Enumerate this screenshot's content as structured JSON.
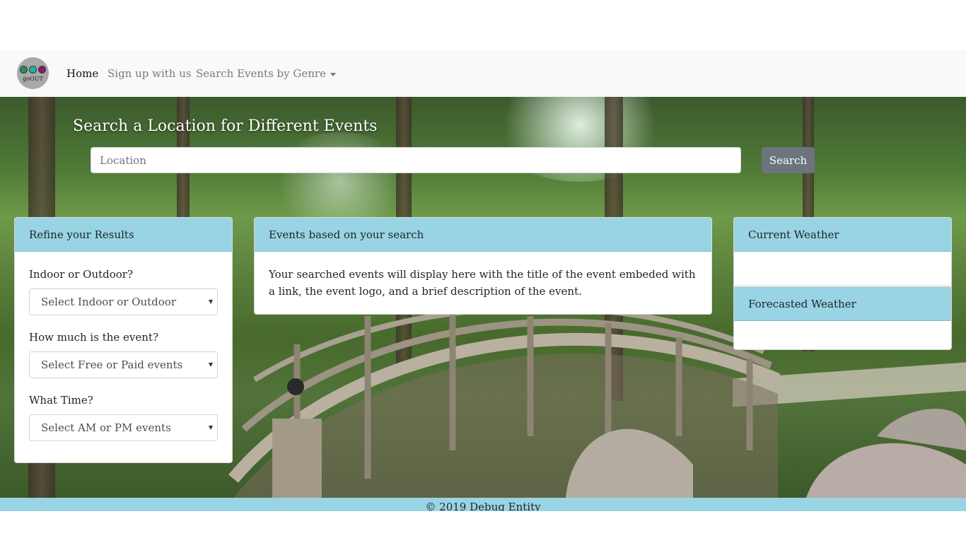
{
  "navbar": {
    "logo_text": "goOUT",
    "logo_colors": [
      "#2e8b57",
      "#20b2aa",
      "#8b1a6b"
    ],
    "links": {
      "home": "Home",
      "signup": "Sign up with us",
      "genre": "Search Events by Genre"
    }
  },
  "hero": {
    "title": "Search a Location for Different Events",
    "search_placeholder": "Location",
    "search_button": "Search"
  },
  "refine": {
    "header": "Refine your Results",
    "fields": [
      {
        "label": "Indoor or Outdoor?",
        "selected": "Select Indoor or Outdoor"
      },
      {
        "label": "How much is the event?",
        "selected": "Select Free or Paid events"
      },
      {
        "label": "What Time?",
        "selected": "Select AM or PM events"
      }
    ]
  },
  "events": {
    "header": "Events based on your search",
    "body": "Your searched events will display here with the title of the event embeded with a link, the event logo, and a brief description of the event."
  },
  "weather": {
    "current_header": "Current Weather",
    "forecast_header": "Forecasted Weather"
  },
  "footer": {
    "text": "© 2019 Debug Entity"
  },
  "colors": {
    "card_header": "#98d4e4",
    "navbar_bg": "#f8f9fa",
    "search_button_bg": "#6c757d"
  }
}
